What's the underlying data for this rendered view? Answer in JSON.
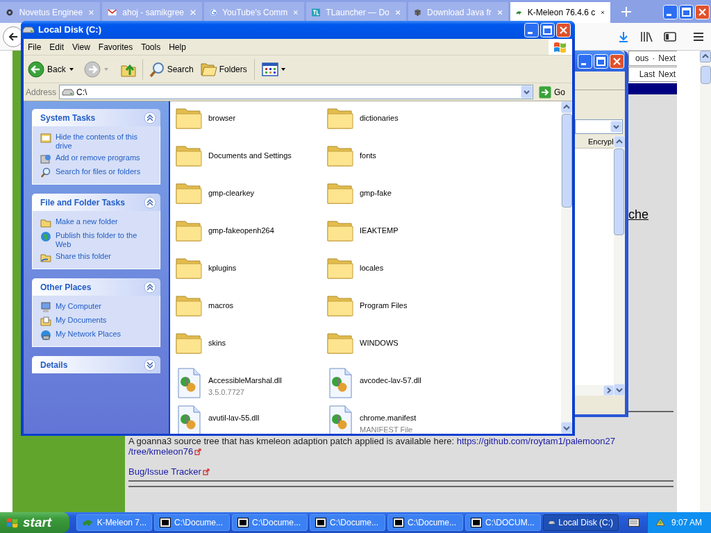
{
  "browser": {
    "tabs": [
      {
        "title": "Novetus Enginee",
        "selected": false
      },
      {
        "title": "ahoj - samikgree",
        "selected": false
      },
      {
        "title": "YouTube's Comm",
        "selected": false
      },
      {
        "title": "TLauncher — Do",
        "selected": false
      },
      {
        "title": "Download Java fr",
        "selected": false
      },
      {
        "title": "K-Meleon 76.4.6 c",
        "selected": true
      }
    ]
  },
  "page": {
    "nav_rows": [
      [
        "ous",
        "·",
        "Next"
      ],
      [
        "Last",
        "Next"
      ]
    ],
    "cut_link": "che",
    "paragraph": "A goanna3 source tree that has kmeleon adaption patch applied is available here:",
    "source_link": [
      "https://github.com/roytam1/palemoon27",
      "/tree/kmeleon76"
    ],
    "tracker_link": "Bug/Issue Tracker"
  },
  "background_window": {
    "column_header": "Encrypl"
  },
  "explorer": {
    "title": "Local Disk (C:)",
    "menu": [
      "File",
      "Edit",
      "View",
      "Favorites",
      "Tools",
      "Help"
    ],
    "toolbar": {
      "back": "Back",
      "search": "Search",
      "folders": "Folders"
    },
    "address": {
      "label": "Address",
      "value": "C:\\",
      "go": "Go"
    },
    "panels": [
      {
        "title": "System Tasks",
        "expanded": true,
        "items": [
          "Hide the contents of this drive",
          "Add or remove programs",
          "Search for files or folders"
        ]
      },
      {
        "title": "File and Folder Tasks",
        "expanded": true,
        "items": [
          "Make a new folder",
          "Publish this folder to the Web",
          "Share this folder"
        ]
      },
      {
        "title": "Other Places",
        "expanded": true,
        "items": [
          "My Computer",
          "My Documents",
          "My Network Places"
        ]
      },
      {
        "title": "Details",
        "expanded": false
      }
    ],
    "files": [
      {
        "name": "browser",
        "kind": "folder"
      },
      {
        "name": "dictionaries",
        "kind": "folder"
      },
      {
        "name": "Documents and Settings",
        "kind": "folder"
      },
      {
        "name": "fonts",
        "kind": "folder"
      },
      {
        "name": "gmp-clearkey",
        "kind": "folder"
      },
      {
        "name": "gmp-fake",
        "kind": "folder"
      },
      {
        "name": "gmp-fakeopenh264",
        "kind": "folder"
      },
      {
        "name": "IEAKTEMP",
        "kind": "folder"
      },
      {
        "name": "kplugins",
        "kind": "folder"
      },
      {
        "name": "locales",
        "kind": "folder"
      },
      {
        "name": "macros",
        "kind": "folder"
      },
      {
        "name": "Program Files",
        "kind": "folder"
      },
      {
        "name": "skins",
        "kind": "folder"
      },
      {
        "name": "WINDOWS",
        "kind": "folder"
      },
      {
        "name": "AccessibleMarshal.dll",
        "kind": "file",
        "detail": "3.5.0.7727"
      },
      {
        "name": "avcodec-lav-57.dll",
        "kind": "file"
      },
      {
        "name": "avutil-lav-55.dll",
        "kind": "file"
      },
      {
        "name": "chrome.manifest",
        "kind": "file",
        "detail": "MANIFEST File"
      }
    ]
  },
  "taskbar": {
    "start": "start",
    "items": [
      {
        "label": "K-Meleon 7...",
        "kind": "browser",
        "selected": false
      },
      {
        "label": "C:\\Docume...",
        "kind": "archive",
        "selected": false
      },
      {
        "label": "C:\\Docume...",
        "kind": "archive",
        "selected": false
      },
      {
        "label": "C:\\Docume...",
        "kind": "archive",
        "selected": false
      },
      {
        "label": "C:\\Docume...",
        "kind": "archive",
        "selected": false
      },
      {
        "label": "C:\\DOCUM...",
        "kind": "archive",
        "selected": false
      },
      {
        "label": "Local Disk (C:)",
        "kind": "disk",
        "selected": true
      }
    ],
    "clock": "9:07 AM"
  }
}
